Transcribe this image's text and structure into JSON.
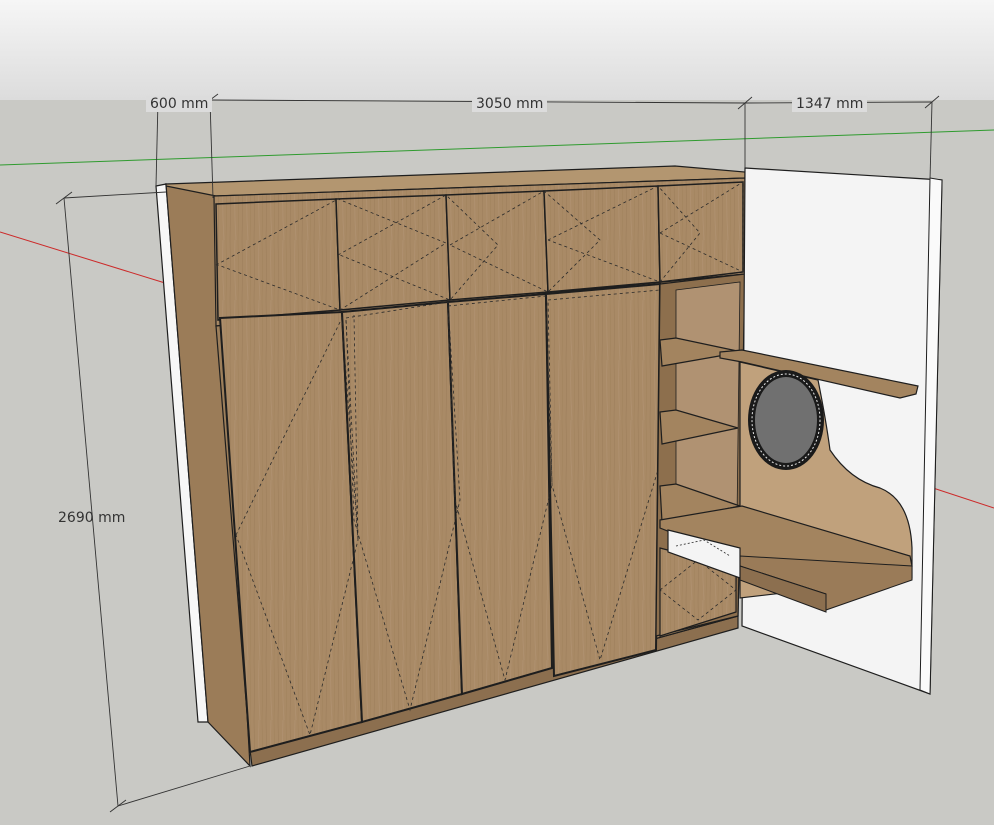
{
  "model": {
    "dimensions": {
      "depth": "600 mm",
      "width_main": "3050 mm",
      "width_side": "1347 mm",
      "height": "2690 mm"
    },
    "colors": {
      "sky_top": "#f4f4f4",
      "sky_bottom": "#dcdcdc",
      "ground": "#c9c9c5",
      "wood": "#a98a66",
      "wood_dark": "#8c6f4f",
      "wood_light": "#b99a74",
      "panel_white": "#f6f6f6",
      "mirror": "#707070",
      "axis_green": "#2f9b2f",
      "axis_red": "#cc2a2a",
      "edge": "#1e1e1e"
    }
  }
}
